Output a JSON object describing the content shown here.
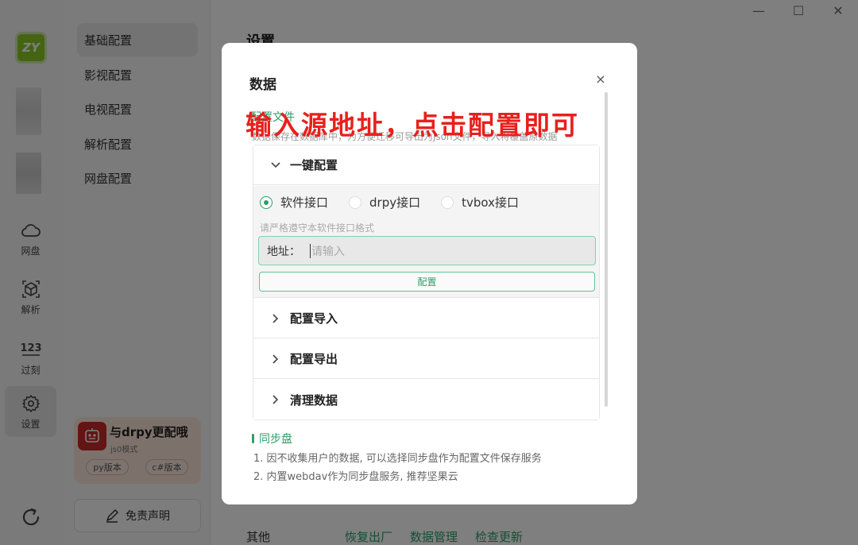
{
  "window": {
    "minimize": "—",
    "maximize": "☐",
    "close": "✕"
  },
  "rail": {
    "logo": "ZY",
    "items": [
      {
        "label": "网盘",
        "icon": "cloud-icon"
      },
      {
        "label": "解析",
        "icon": "cube-icon"
      },
      {
        "label": "过刻",
        "icon": "counter-123-icon"
      },
      {
        "label": "设置",
        "icon": "gear-icon"
      }
    ]
  },
  "subnav": {
    "items": [
      "基础配置",
      "影视配置",
      "电视配置",
      "解析配置",
      "网盘配置"
    ],
    "promo": {
      "title": "与drpy更配哦",
      "subtitle": "js0模式",
      "btn_py": "py版本",
      "btn_cs": "c#版本"
    },
    "disclaimer": "免责声明"
  },
  "main": {
    "title": "设置",
    "bottom": {
      "label": "其他",
      "links": [
        "恢复出厂",
        "数据管理",
        "检查更新"
      ]
    }
  },
  "modal": {
    "title": "数据",
    "close": "×",
    "section_title": "配置文件",
    "section_desc": "数据保存在数据库中，为方便迁移可导出为json文件，导入将覆盖原数据",
    "annotation": "输入源地址，点击配置即可",
    "accordion": {
      "one_click": "一键配置",
      "radios": [
        "软件接口",
        "drpy接口",
        "tvbox接口"
      ],
      "selected": 0,
      "hint": "请严格遵守本软件接口格式",
      "address_label": "地址：",
      "address_placeholder": "请输入",
      "address_value": "",
      "config_button": "配置",
      "import": "配置导入",
      "export": "配置导出",
      "clear": "清理数据"
    },
    "sync": {
      "title": "同步盘",
      "line1": "1. 因不收集用户的数据, 可以选择同步盘作为配置文件保存服务",
      "line2": "2. 内置webdav作为同步盘服务, 推荐坚果云"
    }
  },
  "colors": {
    "accent": "#2e9e6a",
    "annotation": "#e8201c"
  }
}
